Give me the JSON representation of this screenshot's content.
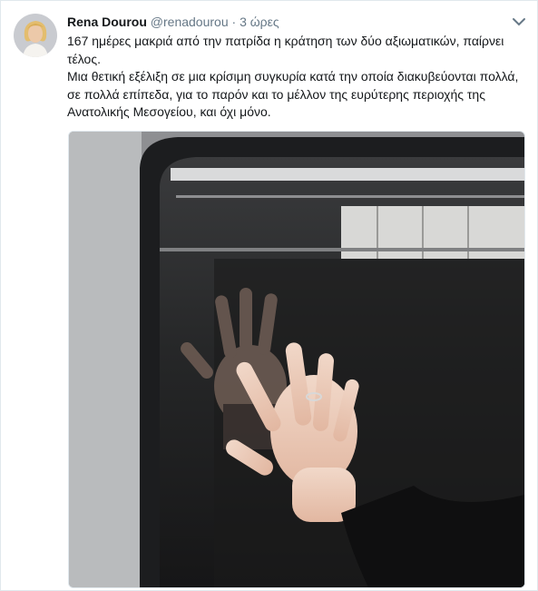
{
  "tweet": {
    "author_name": "Rena Dourou",
    "handle": "@renadourou",
    "separator": "·",
    "time": "3 ώρες",
    "paragraphs": [
      "167 ημέρες μακριά από την πατρίδα η κράτηση των δύο αξιωματικών, παίρνει τέλος.",
      "Μια θετική εξέλιξη σε μια κρίσιμη συγκυρία κατά την οποία διακυβεύονται πολλά, σε πολλά επίπεδα, για το παρόν και το μέλλον της ευρύτερης περιοχής της Ανατολικής Μεσογείου, και όχι μόνο."
    ]
  },
  "icons": {
    "menu": "chevron-down-icon",
    "avatar": "profile-photo"
  },
  "colors": {
    "text": "#14171a",
    "secondary": "#657786",
    "border": "#e1e8ed"
  }
}
